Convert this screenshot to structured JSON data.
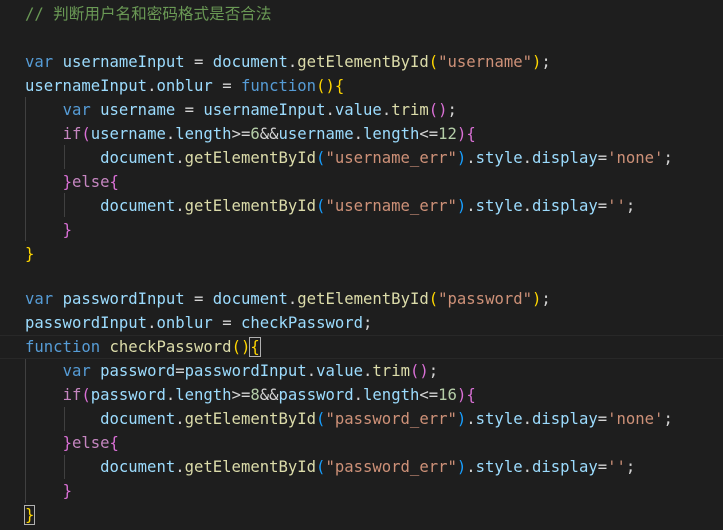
{
  "colors": {
    "background": "#1e1e1e",
    "comment": "#6a9955",
    "keyword": "#569cd6",
    "control": "#c586c0",
    "variable": "#9cdcfe",
    "function": "#dcdcaa",
    "string": "#ce9178",
    "number": "#b5cea8",
    "bracket_level_1": "#ffd700",
    "bracket_level_2": "#da70d6",
    "bracket_level_3": "#179fff"
  },
  "code": {
    "comment": "// 判断用户名和密码格式是否合法",
    "tokens": {
      "var": "var",
      "function": "function",
      "if": "if",
      "else": "else",
      "usernameInput": "usernameInput",
      "passwordInput": "passwordInput",
      "username": "username",
      "password": "password",
      "document": "document",
      "getElementById": "getElementById",
      "onblur": "onblur",
      "value": "value",
      "trim": "trim",
      "length": "length",
      "style": "style",
      "display": "display",
      "checkPassword": "checkPassword",
      "str_username": "\"username\"",
      "str_password": "\"password\"",
      "str_username_err": "\"username_err\"",
      "str_password_err": "\"password_err\"",
      "str_none": "'none'",
      "str_empty": "''",
      "num_6": "6",
      "num_12": "12",
      "num_8": "8",
      "num_16": "16"
    }
  }
}
